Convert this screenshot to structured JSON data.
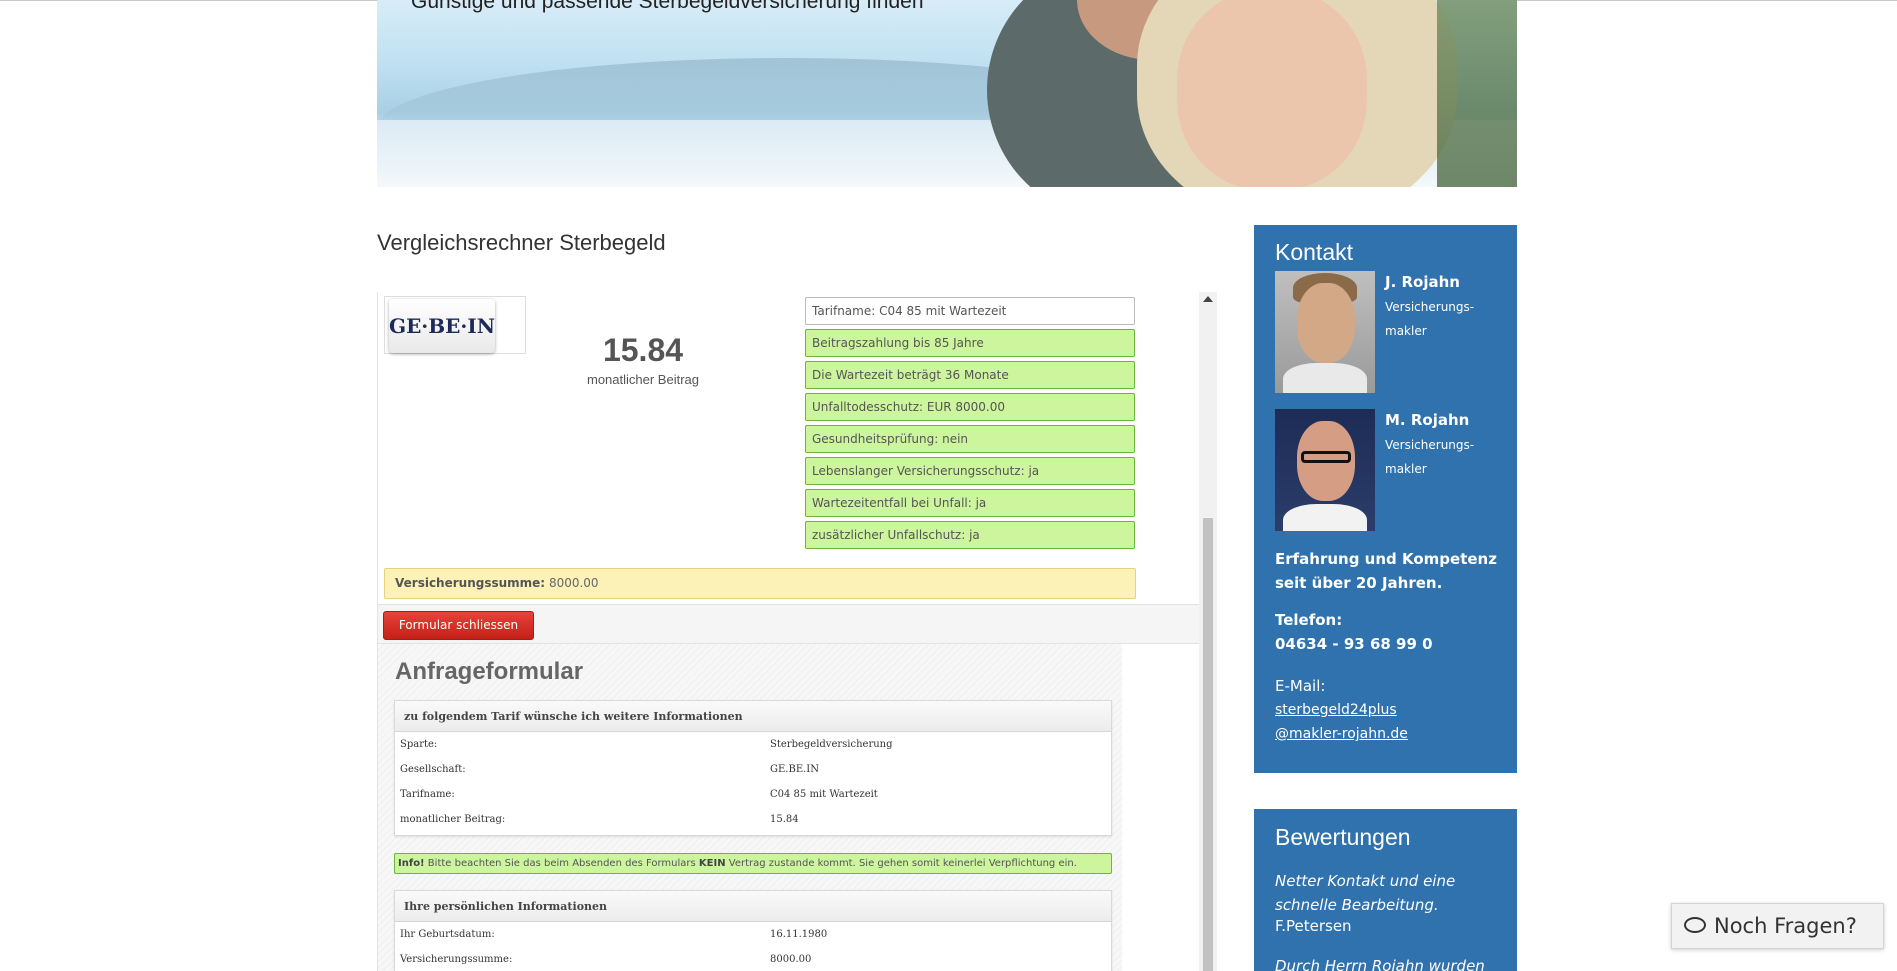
{
  "hero": {
    "caption": "Günstige und passende Sterbegeldversicherung finden"
  },
  "page_title": "Vergleichsrechner Sterbegeld",
  "result": {
    "logo_text": "GE·BE·IN",
    "price": "15.84",
    "price_label": "monatlicher Beitrag",
    "features": [
      "Tarifname: C04 85 mit Wartezeit",
      "Beitragszahlung bis 85 Jahre",
      "Die Wartezeit beträgt 36 Monate",
      "Unfalltodesschutz: EUR 8000.00",
      "Gesundheitsprüfung: nein",
      "Lebenslanger Versicherungsschutz: ja",
      "Wartezeitentfall bei Unfall: ja",
      "zusätzlicher Unfallschutz: ja"
    ],
    "sum_label": "Versicherungssumme:",
    "sum_value": "8000.00",
    "close_button": "Formular schliessen"
  },
  "form": {
    "title": "Anfrageformular",
    "tariff_table": {
      "heading": "zu folgendem Tarif wünsche ich weitere Informationen",
      "rows": [
        {
          "key": "Sparte:",
          "value": "Sterbegeldversicherung"
        },
        {
          "key": "Gesellschaft:",
          "value": "GE.BE.IN"
        },
        {
          "key": "Tarifname:",
          "value": "C04 85 mit Wartezeit"
        },
        {
          "key": "monatlicher Beitrag:",
          "value": "15.84"
        }
      ]
    },
    "notice": {
      "prefix": "Info!",
      "text_before": " Bitte beachten Sie das beim Absenden des Formulars ",
      "emphasis": "KEIN",
      "text_after": " Vertrag zustande kommt. Sie gehen somit keinerlei Verpflichtung ein."
    },
    "personal_table": {
      "heading": "Ihre persönlichen Informationen",
      "rows": [
        {
          "key": "Ihr Geburtsdatum:",
          "value": "16.11.1980"
        },
        {
          "key": "Versicherungssumme:",
          "value": "8000.00"
        }
      ]
    }
  },
  "contact": {
    "title": "Kontakt",
    "persons": [
      {
        "name": "J. Rojahn",
        "role_line1": "Versicherungs-",
        "role_line2": "makler"
      },
      {
        "name": "M. Rojahn",
        "role_line1": "Versicherungs-",
        "role_line2": "makler"
      }
    ],
    "experience_line1": "Erfahrung und Kompetenz",
    "experience_line2": "seit über 20 Jahren.",
    "phone_label": "Telefon:",
    "phone_value": "04634 - 93 68 99 0",
    "email_label": "E-Mail:",
    "email_line1": "sterbegeld24plus",
    "email_line2": "@makler-rojahn.de"
  },
  "reviews": {
    "title": "Bewertungen",
    "review1_line1": "Netter Kontakt und eine",
    "review1_line2": "schnelle Bearbeitung.",
    "review1_author": "F.Petersen",
    "review2_start": "Durch Herrn Rojahn wurden"
  },
  "chat": {
    "label": "Noch Fragen?",
    "icon": "chat-bubbles-icon"
  },
  "colors": {
    "sidebar_blue": "#2f72ad",
    "feature_green": "#ccf59e",
    "sum_yellow": "#fcf2b8",
    "close_red": "#d52e25"
  }
}
